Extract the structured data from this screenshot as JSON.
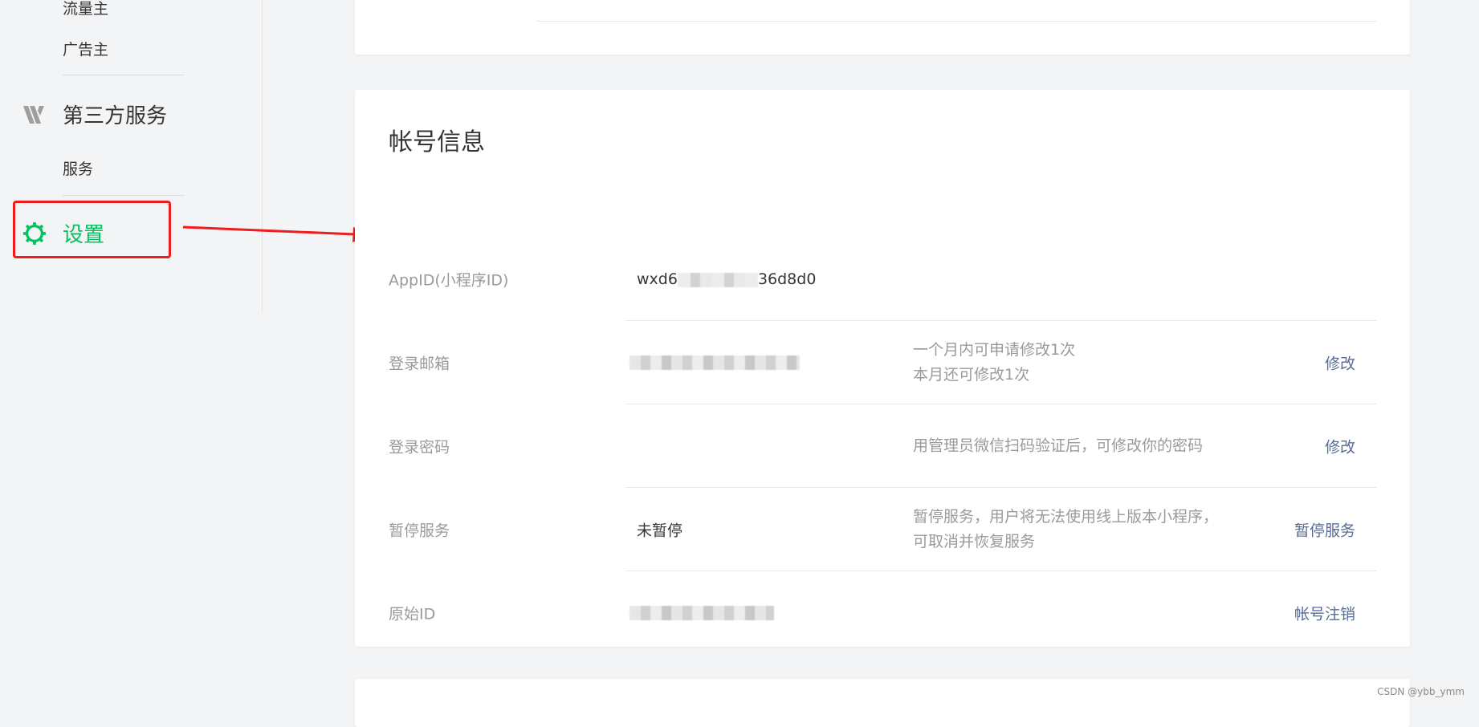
{
  "sidebar": {
    "partial_item": "流量主",
    "items_group1": [
      {
        "label": "广告主"
      }
    ],
    "third_party": {
      "label": "第三方服务",
      "icon": "third-party-icon"
    },
    "items_group2": [
      {
        "label": "服务"
      }
    ],
    "settings": {
      "label": "设置",
      "icon": "gear-icon",
      "active_color": "#07c160"
    }
  },
  "account_info": {
    "title": "帐号信息",
    "rows": [
      {
        "label": "AppID(小程序ID)",
        "value_prefix": "wxd6",
        "value_suffix": "36d8d0"
      },
      {
        "label": "登录邮箱",
        "desc_line1": "一个月内可申请修改1次",
        "desc_line2": "本月还可修改1次",
        "action": "修改"
      },
      {
        "label": "登录密码",
        "desc_line1": "用管理员微信扫码验证后，可修改你的密码",
        "action": "修改"
      },
      {
        "label": "暂停服务",
        "value": "未暂停",
        "desc_line1": "暂停服务，用户将无法使用线上版本小程序，",
        "desc_line2": "可取消并恢复服务",
        "action": "暂停服务"
      },
      {
        "label": "原始ID",
        "action": "帐号注销"
      }
    ]
  },
  "annotation": {
    "highlight_color": "#f01d1d"
  },
  "link_color": "#576b95",
  "watermark": "CSDN @ybb_ymm"
}
